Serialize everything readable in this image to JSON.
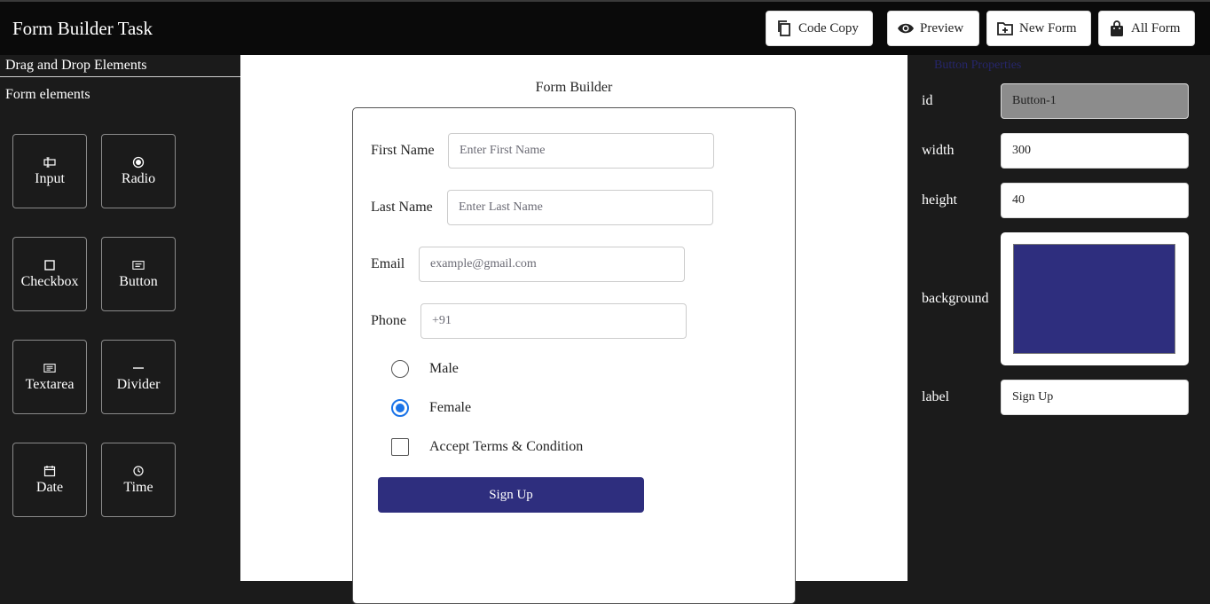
{
  "app": {
    "title": "Form Builder Task"
  },
  "toolbar": {
    "code_copy": "Code Copy",
    "preview": "Preview",
    "new_form": "New Form",
    "all_form": "All Form"
  },
  "sidebar": {
    "heading": "Drag and Drop Elements",
    "subheading": "Form elements",
    "elements": [
      {
        "label": "Input",
        "icon": "input-icon"
      },
      {
        "label": "Radio",
        "icon": "radio-icon"
      },
      {
        "label": "Checkbox",
        "icon": "checkbox-icon"
      },
      {
        "label": "Button",
        "icon": "button-icon"
      },
      {
        "label": "Textarea",
        "icon": "textarea-icon"
      },
      {
        "label": "Divider",
        "icon": "divider-icon"
      },
      {
        "label": "Date",
        "icon": "calendar-icon"
      },
      {
        "label": "Time",
        "icon": "clock-icon"
      }
    ]
  },
  "canvas": {
    "title": "Form Builder",
    "fields": {
      "first_name": {
        "label": "First Name",
        "placeholder": "Enter First Name"
      },
      "last_name": {
        "label": "Last Name",
        "placeholder": "Enter Last Name"
      },
      "email": {
        "label": "Email",
        "placeholder": "example@gmail.com"
      },
      "phone": {
        "label": "Phone",
        "placeholder": "+91"
      }
    },
    "gender_options": [
      {
        "label": "Male",
        "selected": false
      },
      {
        "label": "Female",
        "selected": true
      }
    ],
    "terms": {
      "label": "Accept Terms & Condition",
      "checked": false
    },
    "submit_label": "Sign Up"
  },
  "properties": {
    "heading": "Button Properties",
    "id": {
      "label": "id",
      "value": "Button-1"
    },
    "width": {
      "label": "width",
      "value": "300"
    },
    "height": {
      "label": "height",
      "value": "40"
    },
    "background": {
      "label": "background",
      "value": "#2e2e7e"
    },
    "label": {
      "label": "label",
      "value": "Sign Up"
    }
  }
}
